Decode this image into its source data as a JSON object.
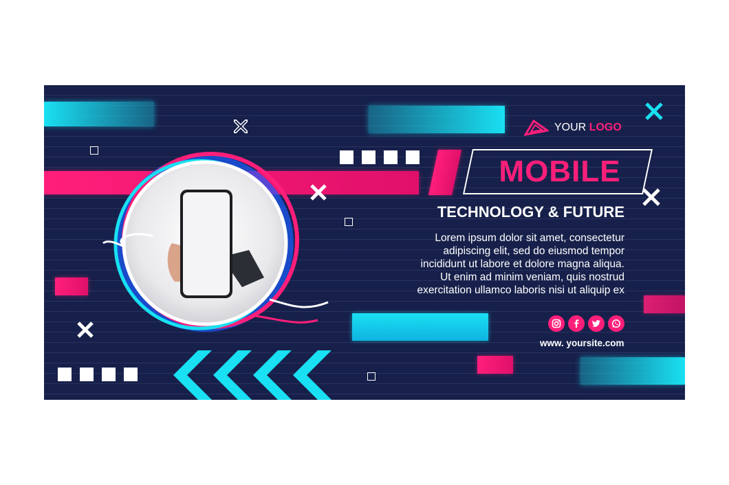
{
  "logo": {
    "prefix": "YOUR",
    "accent": "LOGO",
    "icon": "triangle-logo-icon"
  },
  "headline": "MOBILE",
  "subtitle": "TECHNOLOGY & FUTURE",
  "body_lines": [
    "Lorem ipsum dolor sit amet, consectetur",
    "adipiscing elit, sed do eiusmod tempor",
    "incididunt ut labore et dolore magna aliqua.",
    "Ut enim ad minim veniam, quis nostrud",
    "exercitation ullamco laboris nisi ut aliquip ex"
  ],
  "social_icons": [
    "instagram-icon",
    "facebook-icon",
    "twitter-icon",
    "whatsapp-icon"
  ],
  "website": "www. yoursite.com",
  "colors": {
    "background": "#17204a",
    "accent_pink": "#ff1f7a",
    "accent_cyan": "#19e0f2",
    "text": "#ffffff"
  }
}
